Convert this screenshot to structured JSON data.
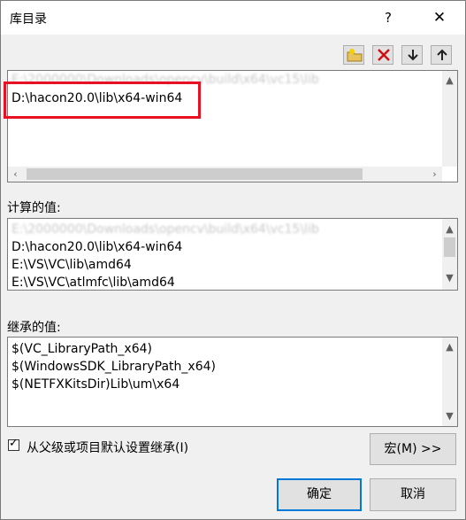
{
  "dialog": {
    "title": "库目录",
    "help": "?",
    "close": "✕"
  },
  "toolbar": {
    "icons": [
      "new-folder-icon",
      "delete-icon",
      "move-down-icon",
      "move-up-icon"
    ]
  },
  "top_list": {
    "lines": [
      "E:\\2000000\\Downloads\\opencv\\build\\x64\\vc15\\lib",
      "D:\\hacon20.0\\lib\\x64-win64"
    ]
  },
  "computed": {
    "label": "计算的值:",
    "lines": [
      "E:\\2000000\\Downloads\\opencv\\build\\x64\\vc15\\lib",
      "D:\\hacon20.0\\lib\\x64-win64",
      "E:\\VS\\VC\\lib\\amd64",
      "E:\\VS\\VC\\atlmfc\\lib\\amd64"
    ]
  },
  "inherited": {
    "label": "继承的值:",
    "lines": [
      "$(VC_LibraryPath_x64)",
      "$(WindowsSDK_LibraryPath_x64)",
      "$(NETFXKitsDir)Lib\\um\\x64"
    ]
  },
  "inherit_checkbox": {
    "checked": true,
    "mark": "✓",
    "label": "从父级或项目默认设置继承(I)"
  },
  "buttons": {
    "macro": "宏(M) >>",
    "ok": "确定",
    "cancel": "取消"
  },
  "colors": {
    "highlight": "#e81123",
    "focus_border": "#0078d7"
  }
}
